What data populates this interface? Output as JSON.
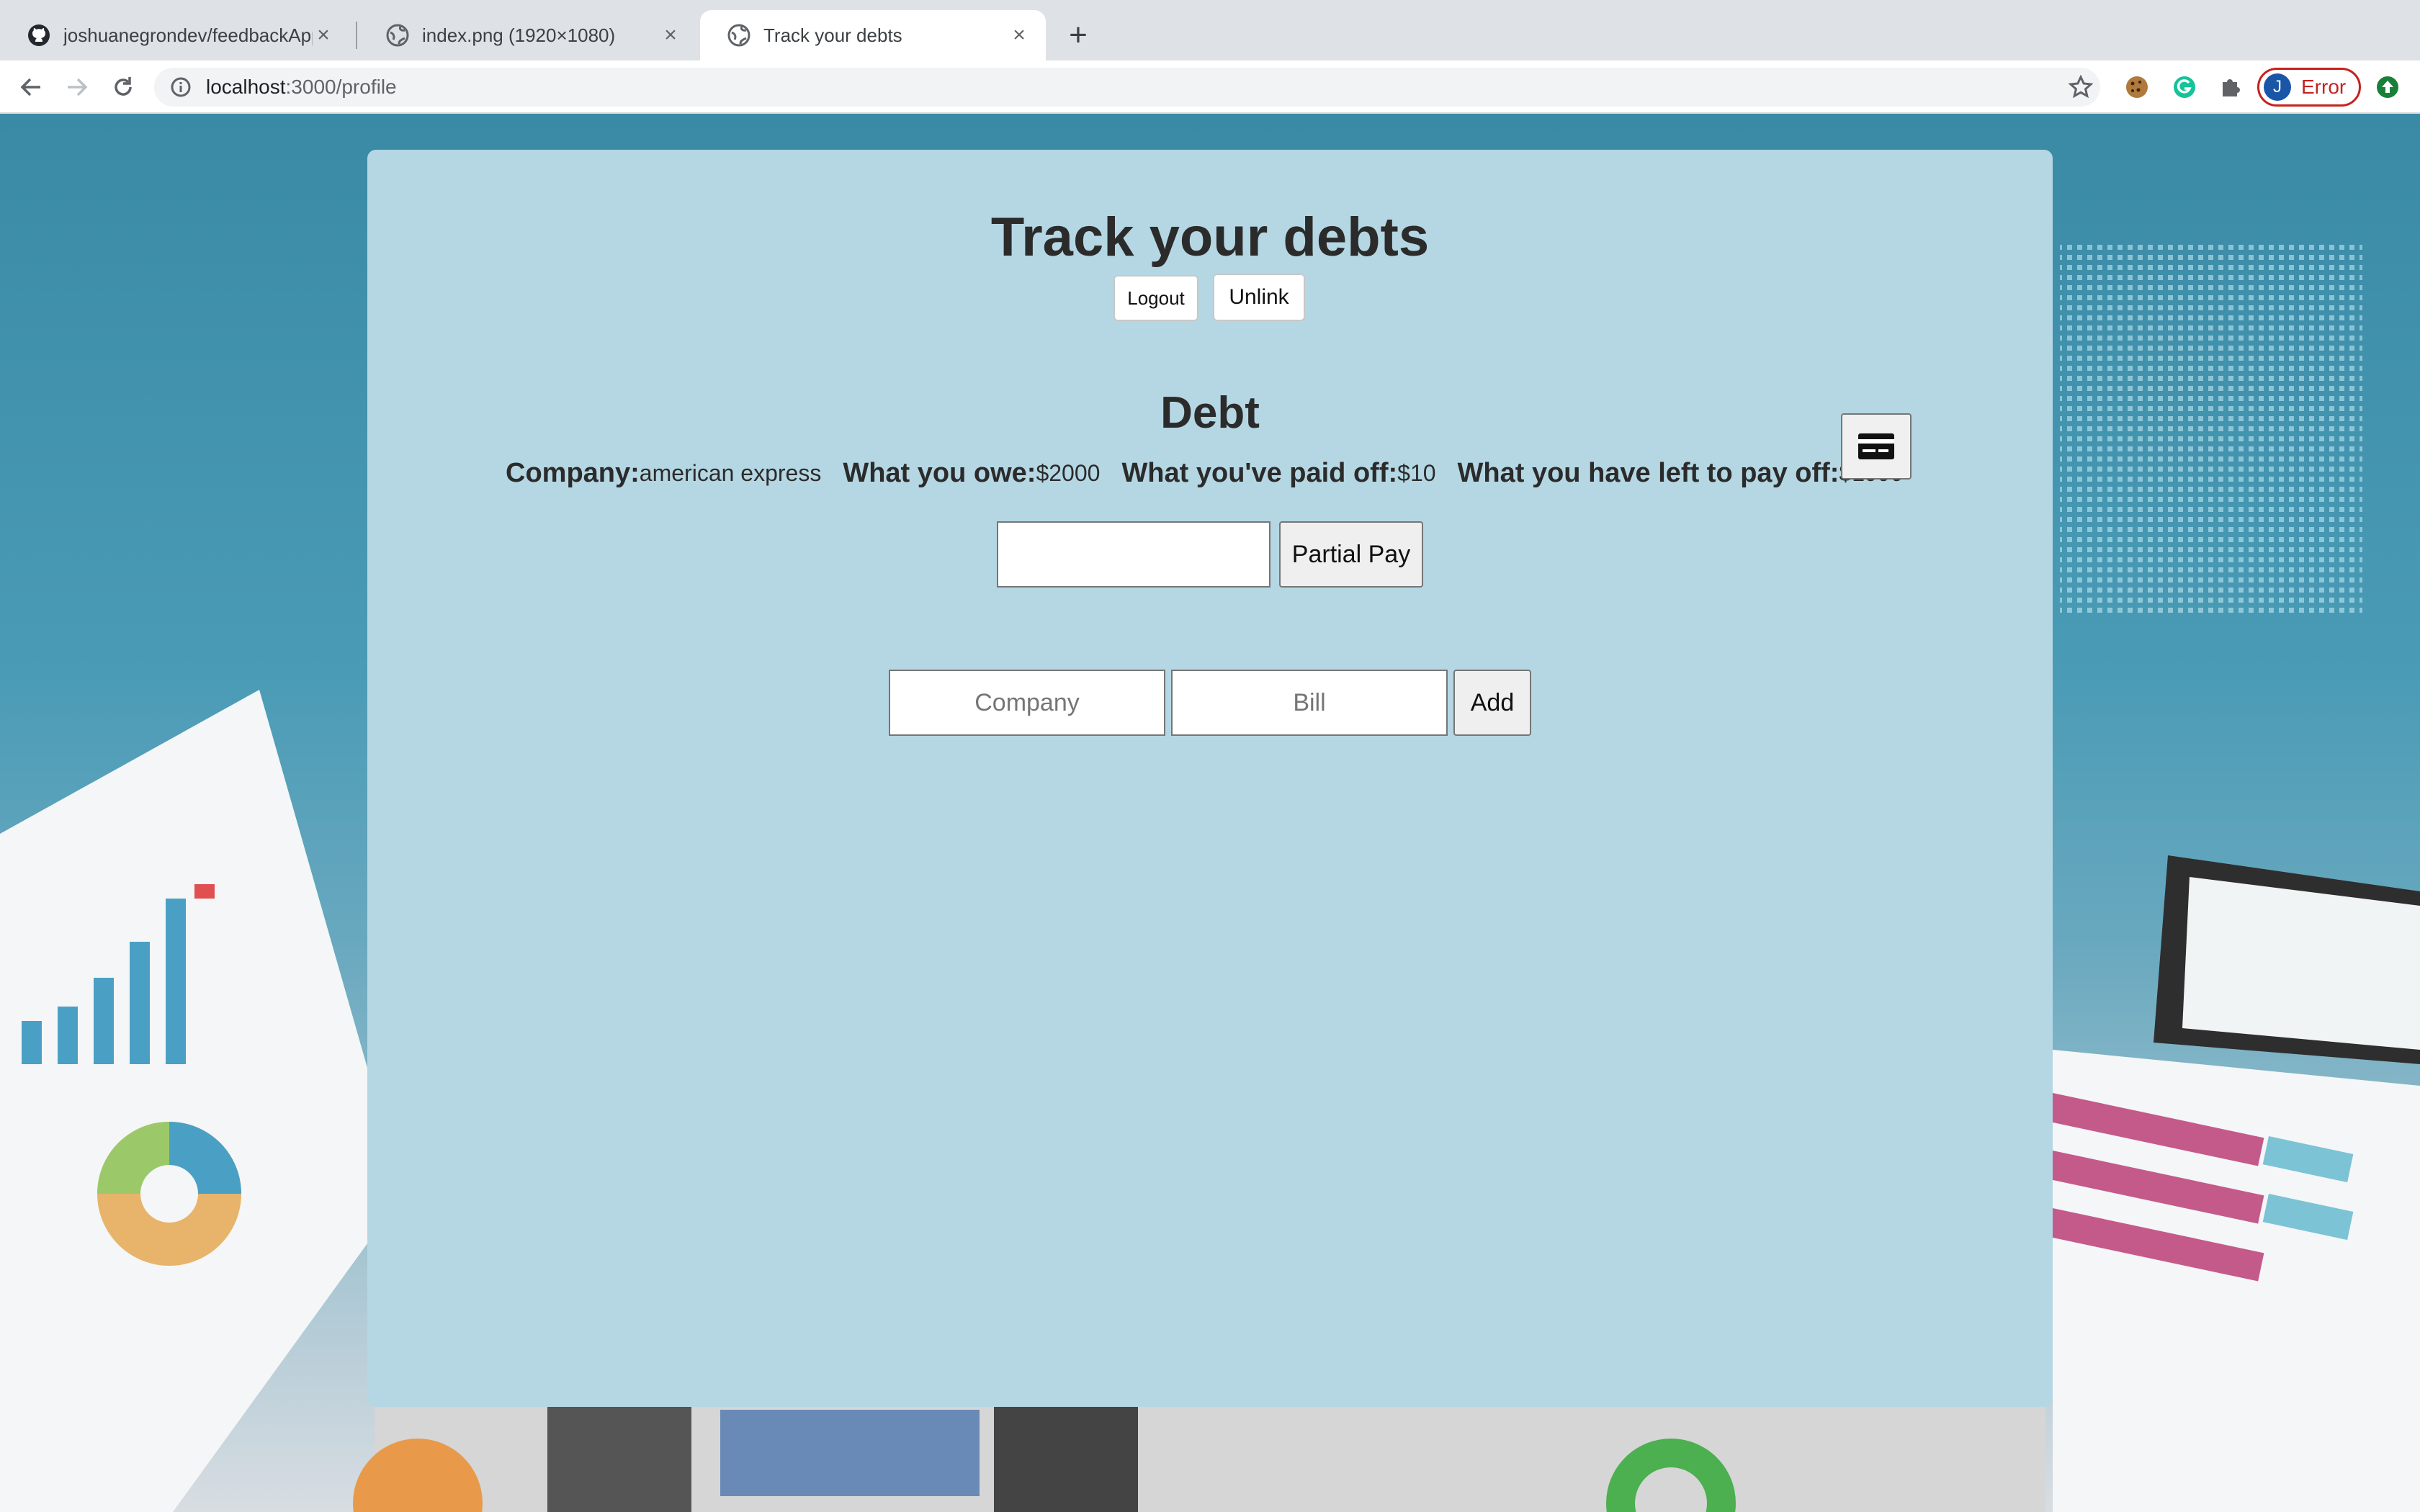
{
  "browser": {
    "tabs": [
      {
        "title": "joshuanegrondev/feedbackApp",
        "active": false
      },
      {
        "title": "index.png (1920×1080)",
        "active": false
      },
      {
        "title": "Track your debts",
        "active": true
      }
    ],
    "url_host": "localhost",
    "url_path": ":3000/profile",
    "profile_initial": "J",
    "profile_status": "Error"
  },
  "page": {
    "title": "Track your debts",
    "logout_label": "Logout",
    "unlink_label": "Unlink",
    "section_title": "Debt",
    "debt": {
      "company_label": "Company:",
      "company_value": "american express",
      "owe_label": "What you owe:",
      "owe_value": "$2000",
      "paid_label": "What you've paid off:",
      "paid_value": "$10",
      "left_label": "What you have left to pay off:",
      "left_value": "$1990"
    },
    "partial_pay_label": "Partial Pay",
    "partial_pay_value": "",
    "company_placeholder": "Company",
    "bill_placeholder": "Bill",
    "add_label": "Add"
  },
  "colors": {
    "card_background": "#b5d7e3",
    "error": "#c5221f"
  }
}
